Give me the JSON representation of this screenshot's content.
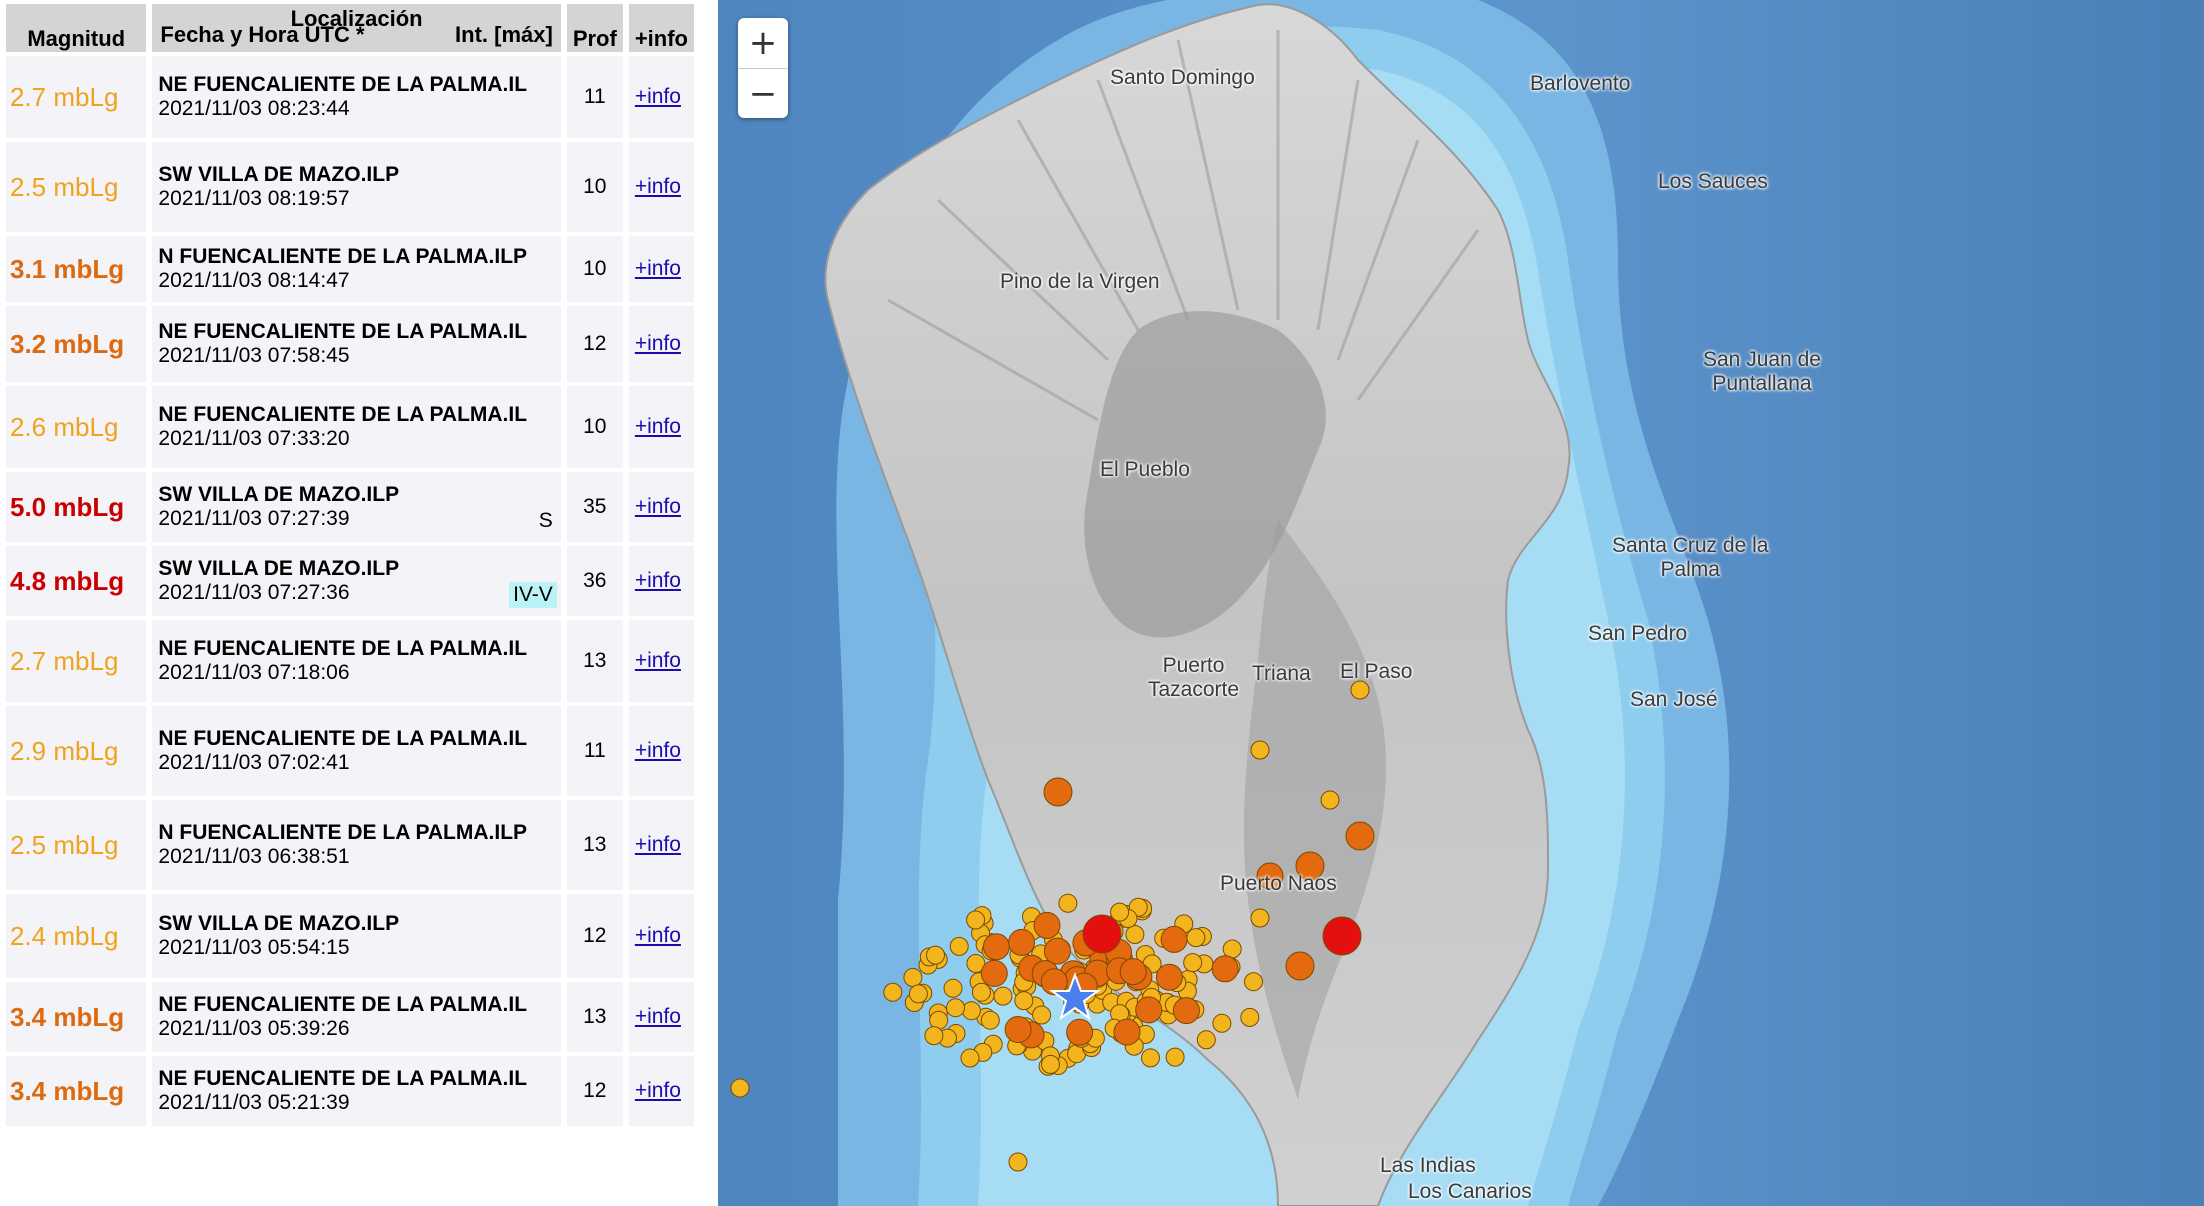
{
  "table": {
    "headers": {
      "magnitud": "Magnitud",
      "localizacion": "Localización",
      "fecha": "Fecha y Hora UTC *",
      "intensidad": "Int. [máx]",
      "prof": "Prof",
      "info": "+info"
    },
    "rows": [
      {
        "mag": "2.7 mbLg",
        "level": "light",
        "loc": "NE FUENCALIENTE DE LA PALMA.IL",
        "date": "2021/11/03 08:23:44",
        "int": "",
        "prof": "11",
        "info": "+info"
      },
      {
        "mag": "2.5 mbLg",
        "level": "light",
        "loc": "SW VILLA DE MAZO.ILP",
        "date": "2021/11/03 08:19:57",
        "int": "",
        "prof": "10",
        "info": "+info"
      },
      {
        "mag": "3.1 mbLg",
        "level": "orange",
        "loc": "N FUENCALIENTE DE LA PALMA.ILP",
        "date": "2021/11/03 08:14:47",
        "int": "",
        "prof": "10",
        "info": "+info"
      },
      {
        "mag": "3.2 mbLg",
        "level": "orange",
        "loc": "NE FUENCALIENTE DE LA PALMA.IL",
        "date": "2021/11/03 07:58:45",
        "int": "",
        "prof": "12",
        "info": "+info"
      },
      {
        "mag": "2.6 mbLg",
        "level": "light",
        "loc": "NE FUENCALIENTE DE LA PALMA.IL",
        "date": "2021/11/03 07:33:20",
        "int": "",
        "prof": "10",
        "info": "+info"
      },
      {
        "mag": "5.0 mbLg",
        "level": "red",
        "loc": "SW VILLA DE MAZO.ILP",
        "date": "2021/11/03 07:27:39",
        "int": "S",
        "prof": "35",
        "info": "+info"
      },
      {
        "mag": "4.8 mbLg",
        "level": "red",
        "loc": "SW VILLA DE MAZO.ILP",
        "date": "2021/11/03 07:27:36",
        "int": "IV-V",
        "prof": "36",
        "info": "+info"
      },
      {
        "mag": "2.7 mbLg",
        "level": "light",
        "loc": "NE FUENCALIENTE DE LA PALMA.IL",
        "date": "2021/11/03 07:18:06",
        "int": "",
        "prof": "13",
        "info": "+info"
      },
      {
        "mag": "2.9 mbLg",
        "level": "light",
        "loc": "NE FUENCALIENTE DE LA PALMA.IL",
        "date": "2021/11/03 07:02:41",
        "int": "",
        "prof": "11",
        "info": "+info"
      },
      {
        "mag": "2.5 mbLg",
        "level": "light",
        "loc": "N FUENCALIENTE DE LA PALMA.ILP",
        "date": "2021/11/03 06:38:51",
        "int": "",
        "prof": "13",
        "info": "+info"
      },
      {
        "mag": "2.4 mbLg",
        "level": "light",
        "loc": "SW VILLA DE MAZO.ILP",
        "date": "2021/11/03 05:54:15",
        "int": "",
        "prof": "12",
        "info": "+info"
      },
      {
        "mag": "3.4 mbLg",
        "level": "orange",
        "loc": "NE FUENCALIENTE DE LA PALMA.IL",
        "date": "2021/11/03 05:39:26",
        "int": "",
        "prof": "13",
        "info": "+info"
      },
      {
        "mag": "3.4 mbLg",
        "level": "orange",
        "loc": "NE FUENCALIENTE DE LA PALMA.IL",
        "date": "2021/11/03 05:21:39",
        "int": "",
        "prof": "12",
        "info": "+info"
      }
    ]
  },
  "map": {
    "zoom_in": "+",
    "zoom_out": "−",
    "places": {
      "santo_domingo": "Santo Domingo",
      "barlovento": "Barlovento",
      "los_sauces": "Los Sauces",
      "pino": "Pino de la Virgen",
      "san_juan_1": "San Juan de",
      "san_juan_2": "Puntallana",
      "el_pueblo": "El Pueblo",
      "santa_cruz_1": "Santa Cruz de la",
      "santa_cruz_2": "Palma",
      "san_pedro": "San Pedro",
      "puerto_1": "Puerto",
      "puerto_2": "Tazacorte",
      "triana": "Triana",
      "el_paso": "El Paso",
      "san_jose": "San José",
      "puerto_naos": "Puerto Naos",
      "las_indias": "Las Indias",
      "los_canarios": "Los Canarios"
    },
    "colors": {
      "small": "#f2b51e",
      "medium": "#e46a10",
      "large": "#e41010",
      "star": "#4a7ff0"
    }
  }
}
